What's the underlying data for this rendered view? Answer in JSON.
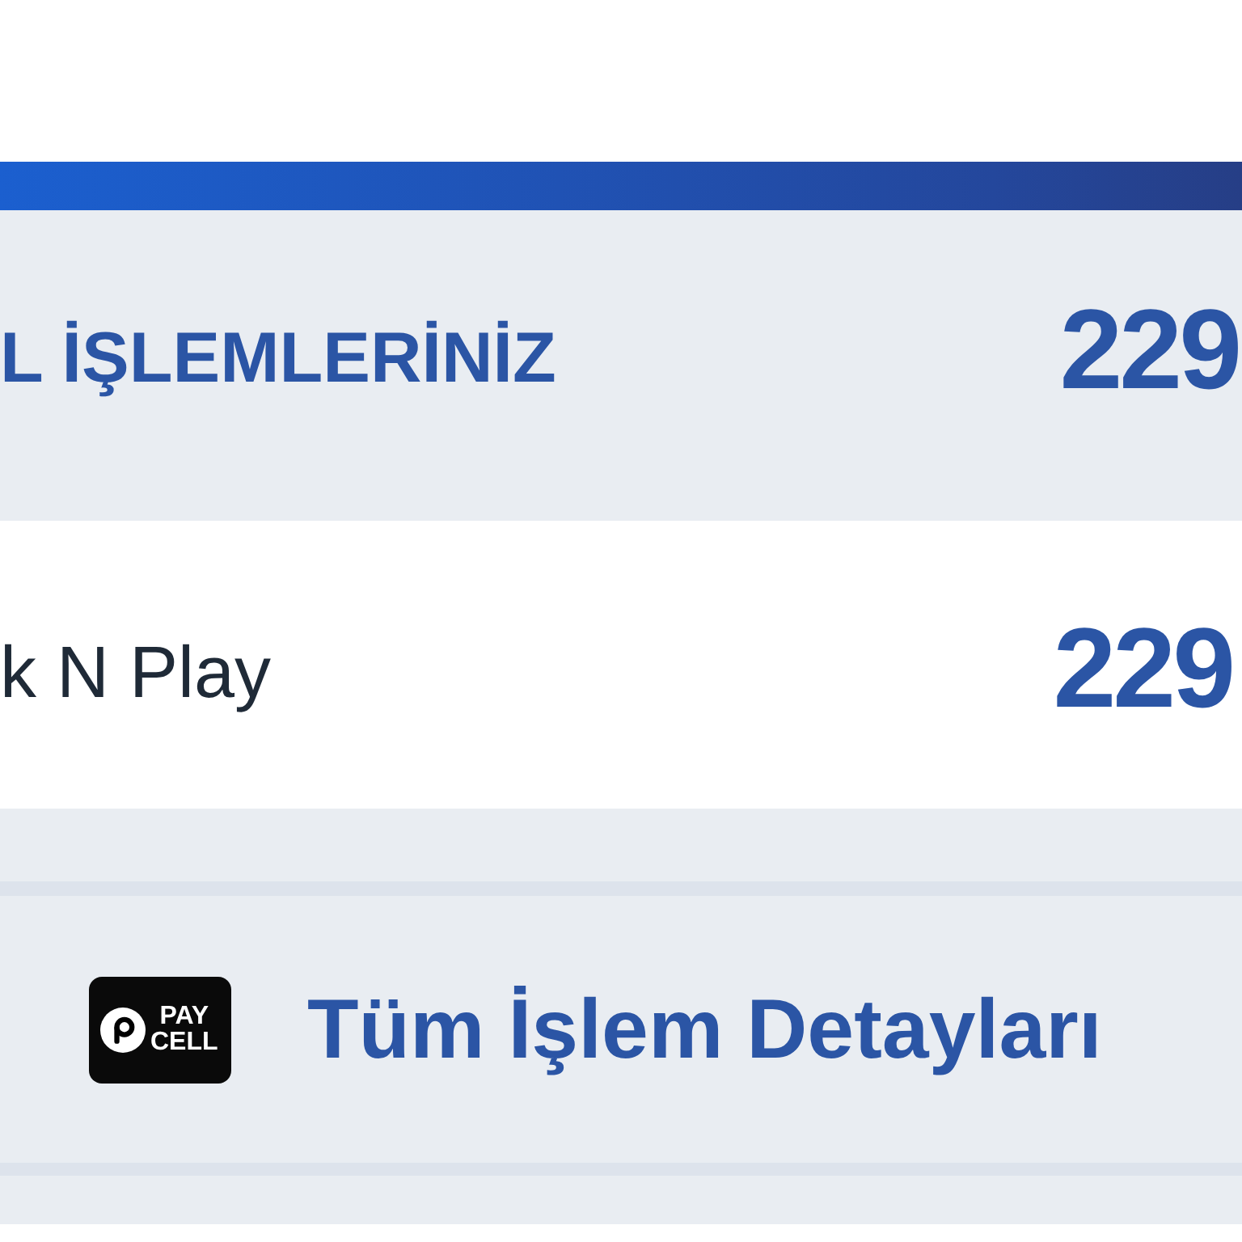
{
  "summary": {
    "title": "L İŞLEMLERİNİZ",
    "amount": "229"
  },
  "transactions": [
    {
      "name": "k N Play",
      "amount": "229"
    }
  ],
  "details": {
    "logo_text": [
      "PAY",
      "CELL"
    ],
    "label": "Tüm İşlem Detayları"
  }
}
